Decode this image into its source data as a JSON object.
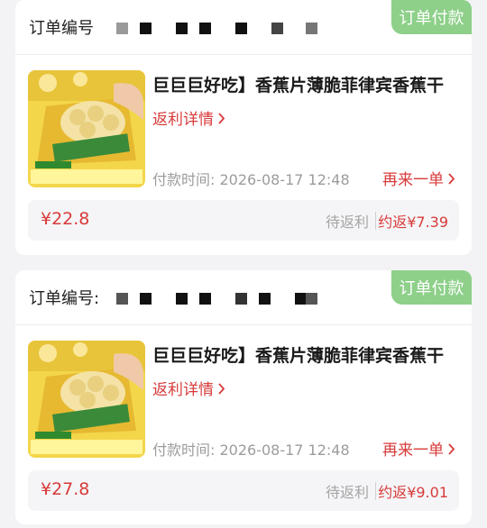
{
  "orders": [
    {
      "order_label": "订单编号",
      "badge": "订单付款",
      "product_image_label": "香蕉片",
      "title": "巨巨巨好吃】香蕉片薄脆菲律宾香蕉干",
      "rebate_link": "返利详情",
      "pay_time": "付款时间: 2026-08-17 12:48",
      "buy_again": "再来一单",
      "price": "¥22.8",
      "status": "待返利",
      "estimated_rebate": "约返¥7.39"
    },
    {
      "order_label": "订单编号:",
      "badge": "订单付款",
      "product_image_label": "香蕉片",
      "title": "巨巨巨好吃】香蕉片薄脆菲律宾香蕉干",
      "rebate_link": "返利详情",
      "pay_time": "付款时间: 2026-08-17 12:48",
      "buy_again": "再来一单",
      "price": "¥27.8",
      "status": "待返利",
      "estimated_rebate": "约返¥9.01"
    }
  ],
  "icons": {
    "link_chevron": "chevron-right-icon"
  },
  "colors": {
    "accent_red": "#d83a3a",
    "badge_green": "#8ed08a",
    "product_yellow": "#f3d64a"
  }
}
